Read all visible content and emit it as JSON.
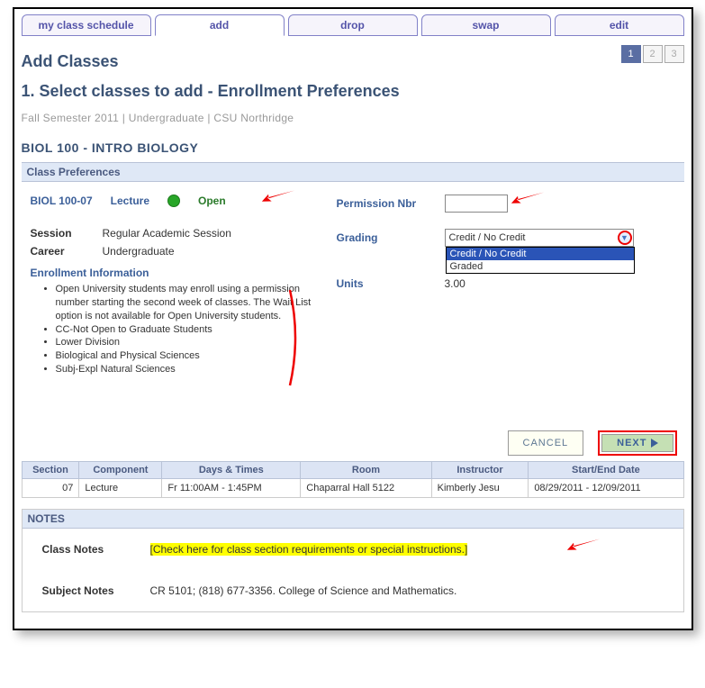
{
  "tabs": [
    "my class schedule",
    "add",
    "drop",
    "swap",
    "edit"
  ],
  "active_tab": 1,
  "page_title": "Add Classes",
  "steps": [
    "1",
    "2",
    "3"
  ],
  "active_step": 0,
  "step_heading": "1.  Select classes to add - Enrollment Preferences",
  "term_line": "Fall Semester 2011 | Undergraduate | CSU Northridge",
  "course_title": "BIOL  100 - INTRO BIOLOGY",
  "class_prefs_heading": "Class Preferences",
  "class_link": "BIOL  100-07",
  "lecture_label": "Lecture",
  "status_label": "Open",
  "session_label": "Session",
  "session_value": "Regular Academic Session",
  "career_label": "Career",
  "career_value": "Undergraduate",
  "enroll_heading": "Enrollment Information",
  "enroll_items": [
    "Open University students may enroll using a permission number starting the second week of classes. The Wait List option is not available for Open University students.",
    "CC-Not Open to Graduate Students",
    "Lower Division",
    "Biological and Physical Sciences",
    "Subj-Expl Natural Sciences"
  ],
  "perm_label": "Permission Nbr",
  "perm_value": "",
  "grading_label": "Grading",
  "grading_selected": "Credit / No Credit",
  "grading_options": [
    "Credit / No Credit",
    "Graded"
  ],
  "units_label": "Units",
  "units_value": "3.00",
  "cancel_label": "CANCEL",
  "next_label": "NEXT",
  "sched_headers": [
    "Section",
    "Component",
    "Days & Times",
    "Room",
    "Instructor",
    "Start/End Date"
  ],
  "sched_row": {
    "section": "07",
    "component": "Lecture",
    "days": "Fr 11:00AM - 1:45PM",
    "room": "Chaparral Hall 5122",
    "instructor": "Kimberly Jesu",
    "dates": "08/29/2011 - 12/09/2011"
  },
  "notes_heading": "NOTES",
  "class_notes_label": "Class Notes",
  "class_notes_value": "[Check here for class section requirements or special instructions.]",
  "subject_notes_label": "Subject Notes",
  "subject_notes_value": "CR 5101; (818) 677-3356. College of Science and Mathematics."
}
